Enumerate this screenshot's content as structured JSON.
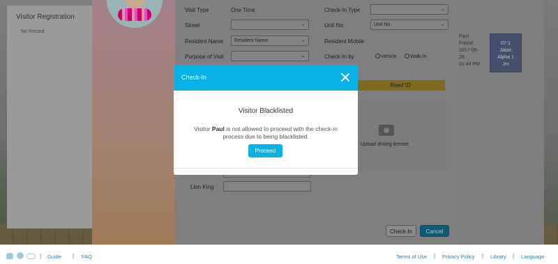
{
  "background": {
    "panel_title": "Visitor Registration",
    "panel_status": "No Record",
    "visitor_info": [
      "Paul",
      "Friend",
      "2017-06-",
      "26",
      "01:44 PM"
    ],
    "visitor_card": [
      "07-1",
      "Jalan",
      "Alpha 1",
      "Jm"
    ]
  },
  "form": {
    "visit_type_label": "Visit Type",
    "visit_type_value": "One Time",
    "checkin_type_label": "Check-In Type",
    "street_label": "Street",
    "unit_no_label": "Unit No.",
    "unit_no_select": "Unit No.",
    "resident_name_label": "Resident Name",
    "resident_name_select": "Resident Name",
    "resident_mobile_label": "Resident Mobile",
    "purpose_label": "Purpose of Visit",
    "checkin_by_label": "Check-In by",
    "vehicle_option": "Vehicle",
    "walkin_option": "Walk-In",
    "read_id_button": "Read ID",
    "upload_label": "Upload driving license",
    "lion_king_label": "Lion King",
    "checkin_button": "Check-In",
    "cancel_button": "Cancel"
  },
  "dialog": {
    "title": "Check-In",
    "heading": "Visitor Blacklisted",
    "msg_prefix": "Visitor ",
    "msg_name": "Paul",
    "msg_suffix": " is not allowed to proceed with the check-in process due to being blacklisted.",
    "proceed_button": "Proceed"
  },
  "footer": {
    "guide": "Guide",
    "faq": "FAQ",
    "terms": "Terms of Use",
    "privacy": "Privacy Policy",
    "library": "Library",
    "language": "Language",
    "separator": "|"
  },
  "colors": {
    "accent": "#08b1e6",
    "read_id": "#e8c23a",
    "cancel": "#1fa9d8",
    "link": "#2a7da8"
  }
}
